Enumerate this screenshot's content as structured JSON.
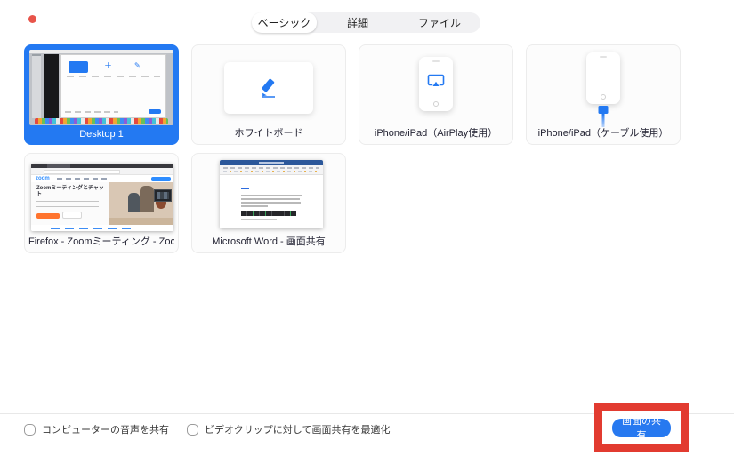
{
  "window": {
    "close_dot_color": "#e8544a"
  },
  "tabs": {
    "items": [
      {
        "label": "ベーシック",
        "selected": true
      },
      {
        "label": "詳細",
        "selected": false
      },
      {
        "label": "ファイル",
        "selected": false
      }
    ]
  },
  "tiles": {
    "desktop": {
      "label": "Desktop 1",
      "selected": true
    },
    "whiteboard": {
      "label": "ホワイトボード"
    },
    "iphone_airplay": {
      "label": "iPhone/iPad（AirPlay使用）"
    },
    "iphone_cable": {
      "label": "iPhone/iPad（ケーブル使用）"
    },
    "firefox": {
      "label": "Firefox - Zoomミーティング - Zoom...",
      "thumb": {
        "logo": "zoom",
        "hero_title": "Zoomミーティングとチャット"
      }
    },
    "word": {
      "label": "Microsoft Word - 画面共有"
    }
  },
  "footer": {
    "checkboxes": [
      {
        "label": "コンピューターの音声を共有",
        "checked": false
      },
      {
        "label": "ビデオクリップに対して画面共有を最適化",
        "checked": false
      }
    ],
    "share_button_label": "画面の共有"
  },
  "colors": {
    "accent_blue": "#2379f2",
    "button_blue": "#2779f0",
    "annotation_red": "#e23b30"
  }
}
